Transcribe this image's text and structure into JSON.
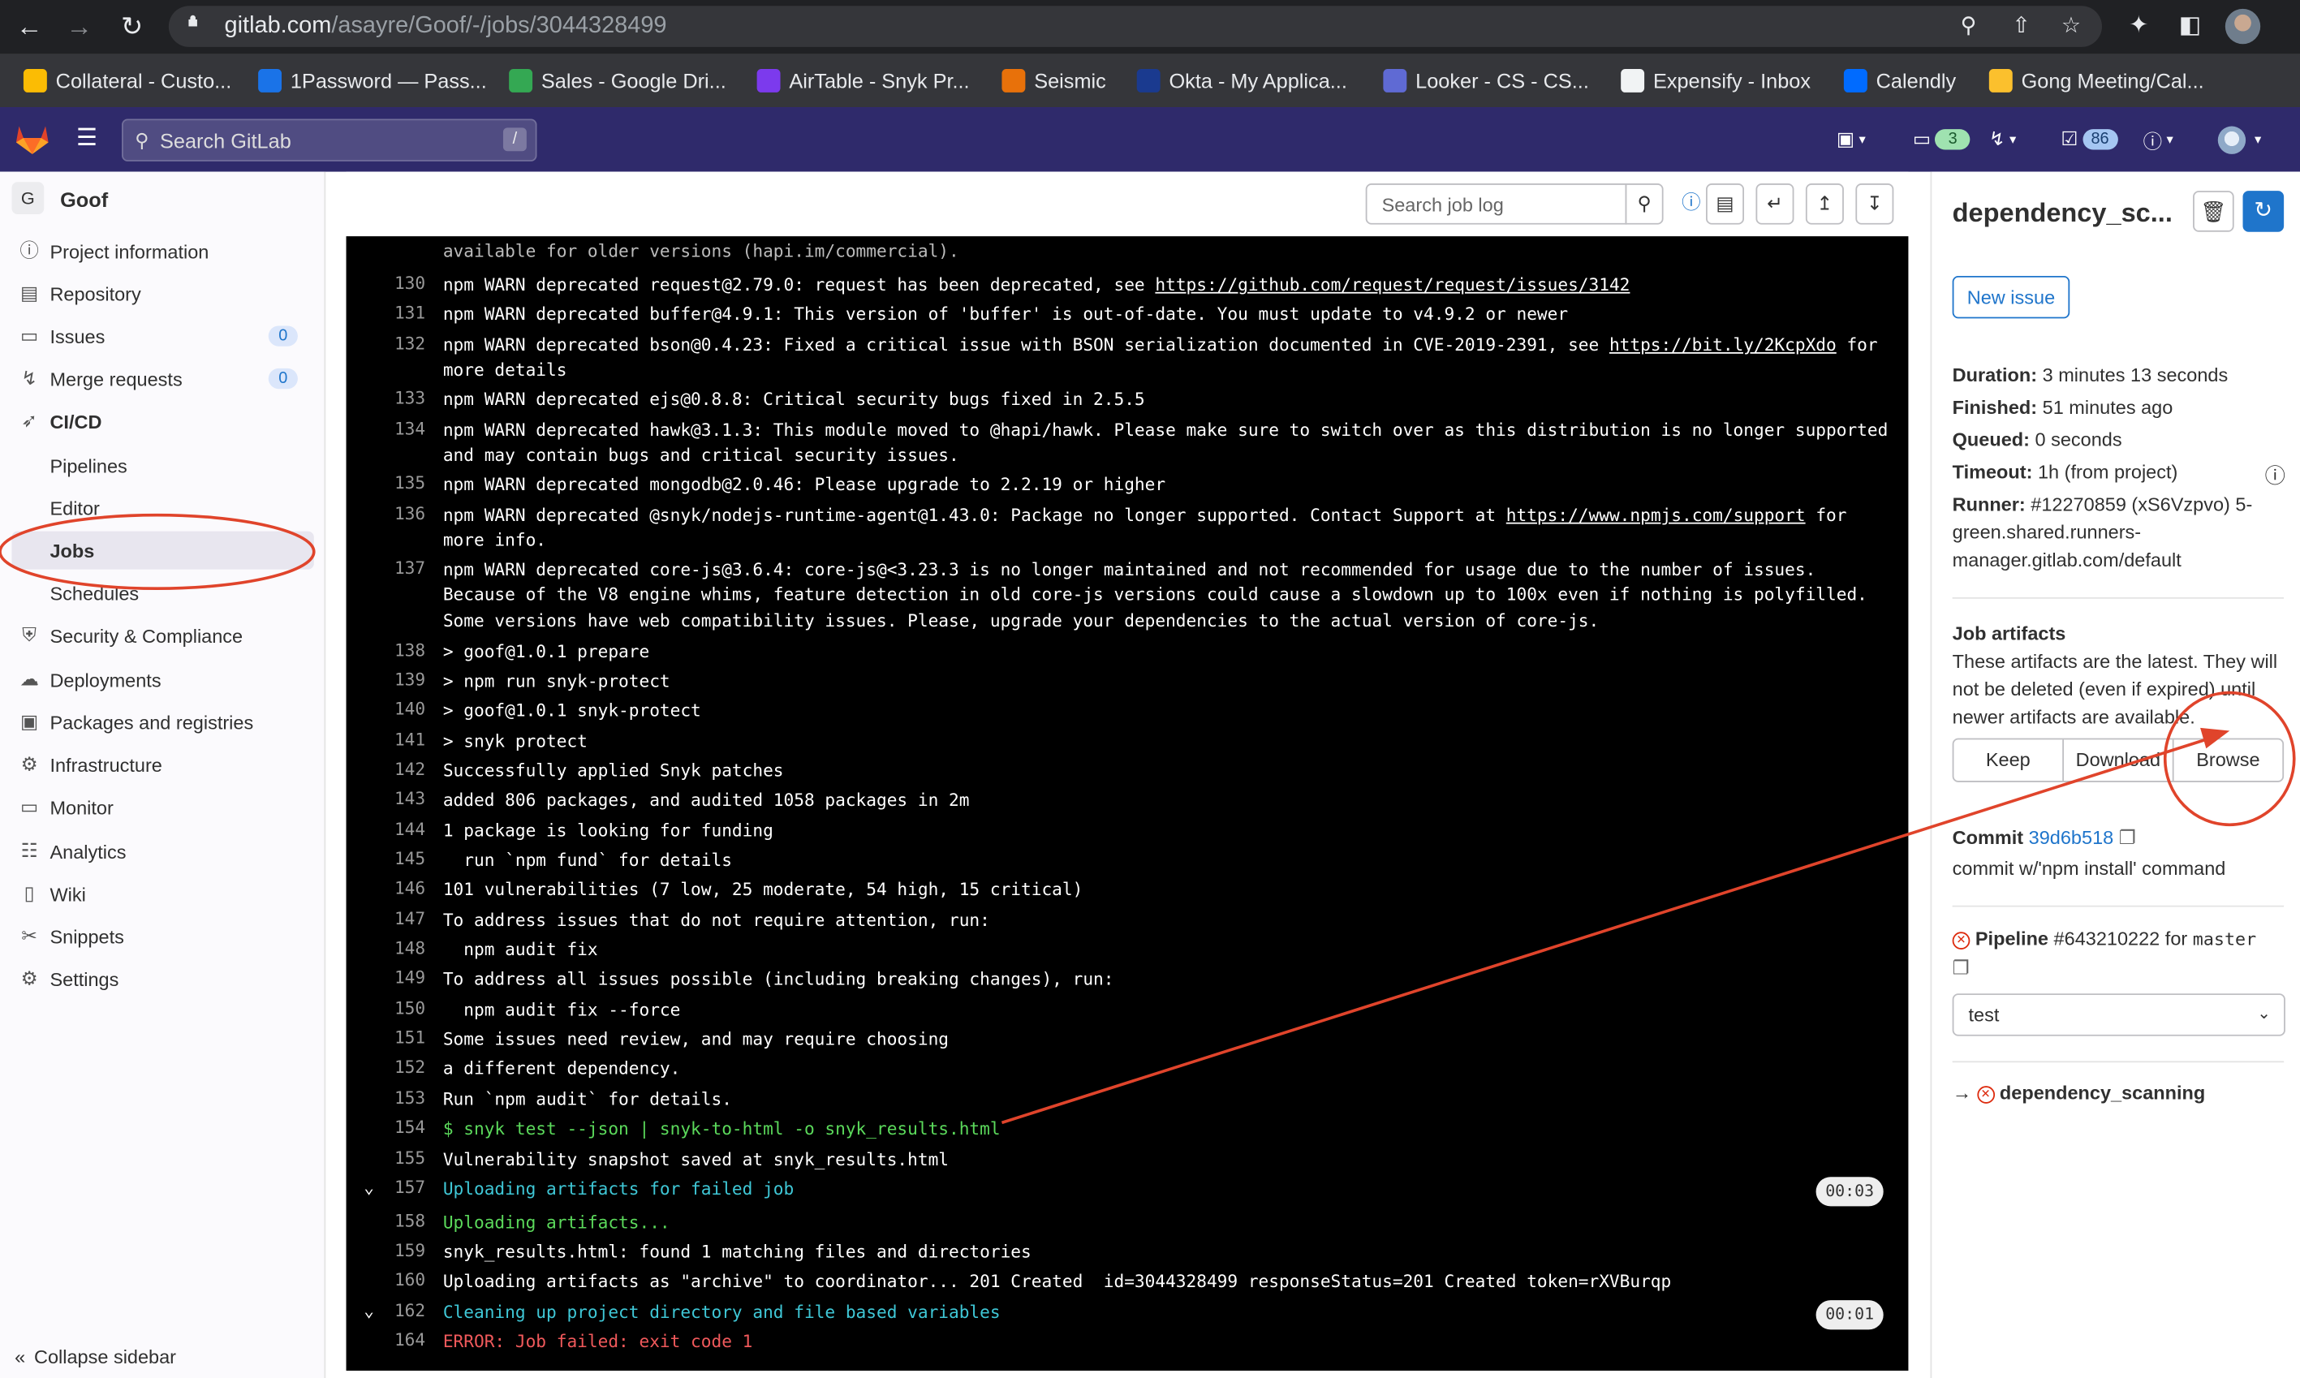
{
  "browser": {
    "url_host": "gitlab.com",
    "url_path": "/asayre/Goof/-/jobs/3044328499",
    "icons": [
      "back-icon",
      "forward-icon",
      "reload-icon",
      "lock-icon",
      "zoom-icon",
      "share-icon",
      "star-icon",
      "extensions-icon",
      "sidebar-icon",
      "profile-avatar"
    ],
    "bookmarks": [
      {
        "label": "Collateral - Custo...",
        "color": "#fbbc04"
      },
      {
        "label": "1Password — Pass...",
        "color": "#1a73e8"
      },
      {
        "label": "Sales - Google Dri...",
        "color": "#34a853"
      },
      {
        "label": "AirTable - Snyk Pr...",
        "color": "#7c3aed"
      },
      {
        "label": "Seismic",
        "color": "#e8710a"
      },
      {
        "label": "Okta - My Applica...",
        "color": "#1a3a8f"
      },
      {
        "label": "Looker - CS - CS...",
        "color": "#5f6ad4"
      },
      {
        "label": "Expensify - Inbox",
        "color": "#f1f3f4"
      },
      {
        "label": "Calendly",
        "color": "#006bff"
      },
      {
        "label": "Gong Meeting/Cal...",
        "color": "#fbc02d"
      }
    ]
  },
  "gitlab_header": {
    "search_placeholder": "Search GitLab",
    "search_kbd": "/",
    "issues_count": "3",
    "todos_count": "86",
    "accent": "#2f2a6b"
  },
  "sidebar": {
    "project_initial": "G",
    "project_name": "Goof",
    "items": [
      {
        "label": "Project information",
        "icon": "info-icon"
      },
      {
        "label": "Repository",
        "icon": "doc-icon"
      },
      {
        "label": "Issues",
        "icon": "issues-icon",
        "badge": "0"
      },
      {
        "label": "Merge requests",
        "icon": "merge-request-icon",
        "badge": "0"
      },
      {
        "label": "CI/CD",
        "icon": "rocket-icon"
      },
      {
        "label": "Pipelines"
      },
      {
        "label": "Editor"
      },
      {
        "label": "Jobs"
      },
      {
        "label": "Schedules"
      },
      {
        "label": "Security & Compliance",
        "icon": "shield-icon"
      },
      {
        "label": "Deployments",
        "icon": "deploy-icon"
      },
      {
        "label": "Packages and registries",
        "icon": "package-icon"
      },
      {
        "label": "Infrastructure",
        "icon": "cloud-icon"
      },
      {
        "label": "Monitor",
        "icon": "monitor-icon"
      },
      {
        "label": "Analytics",
        "icon": "chart-icon"
      },
      {
        "label": "Wiki",
        "icon": "book-icon"
      },
      {
        "label": "Snippets",
        "icon": "snippet-icon"
      },
      {
        "label": "Settings",
        "icon": "gear-icon"
      }
    ],
    "collapse_label": "Collapse sidebar"
  },
  "log_toolbar": {
    "search_placeholder": "Search job log"
  },
  "log": {
    "top_fragment": "available for older versions (hapi.im/commercial).",
    "lines": [
      {
        "n": "130",
        "parts": [
          {
            "t": "npm WARN deprecated request@2.79.0: request has been deprecated, see "
          },
          {
            "t": "https://github.com/request/request/issues/3142",
            "link": true
          }
        ]
      },
      {
        "n": "131",
        "parts": [
          {
            "t": "npm WARN deprecated buffer@4.9.1: This version of 'buffer' is out-of-date. You must update to v4.9.2 or newer"
          }
        ]
      },
      {
        "n": "132",
        "parts": [
          {
            "t": "npm WARN deprecated bson@0.4.23: Fixed a critical issue with BSON serialization documented in CVE-2019-2391, see "
          },
          {
            "t": "https://bit.ly/2KcpXdo",
            "link": true
          },
          {
            "t": " for more details"
          }
        ]
      },
      {
        "n": "133",
        "parts": [
          {
            "t": "npm WARN deprecated ejs@0.8.8: Critical security bugs fixed in 2.5.5"
          }
        ]
      },
      {
        "n": "134",
        "parts": [
          {
            "t": "npm WARN deprecated hawk@3.1.3: This module moved to @hapi/hawk. Please make sure to switch over as this distribution is no longer supported and may contain bugs and critical security issues."
          }
        ]
      },
      {
        "n": "135",
        "parts": [
          {
            "t": "npm WARN deprecated mongodb@2.0.46: Please upgrade to 2.2.19 or higher"
          }
        ]
      },
      {
        "n": "136",
        "parts": [
          {
            "t": "npm WARN deprecated @snyk/nodejs-runtime-agent@1.43.0: Package no longer supported. Contact Support at "
          },
          {
            "t": "https://www.npmjs.com/support",
            "link": true
          },
          {
            "t": " for more info."
          }
        ]
      },
      {
        "n": "137",
        "parts": [
          {
            "t": "npm WARN deprecated core-js@3.6.4: core-js@<3.23.3 is no longer maintained and not recommended for usage due to the number of issues. Because of the V8 engine whims, feature detection in old core-js versions could cause a slowdown up to 100x even if nothing is polyfilled. Some versions have web compatibility issues. Please, upgrade your dependencies to the actual version of core-js."
          }
        ]
      },
      {
        "n": "138",
        "parts": [
          {
            "t": "> goof@1.0.1 prepare"
          }
        ]
      },
      {
        "n": "139",
        "parts": [
          {
            "t": "> npm run snyk-protect"
          }
        ]
      },
      {
        "n": "140",
        "parts": [
          {
            "t": "> goof@1.0.1 snyk-protect"
          }
        ]
      },
      {
        "n": "141",
        "parts": [
          {
            "t": "> snyk protect"
          }
        ]
      },
      {
        "n": "142",
        "parts": [
          {
            "t": "Successfully applied Snyk patches"
          }
        ]
      },
      {
        "n": "143",
        "parts": [
          {
            "t": "added 806 packages, and audited 1058 packages in 2m"
          }
        ]
      },
      {
        "n": "144",
        "parts": [
          {
            "t": "1 package is looking for funding"
          }
        ]
      },
      {
        "n": "145",
        "parts": [
          {
            "t": "  run `npm fund` for details"
          }
        ]
      },
      {
        "n": "146",
        "parts": [
          {
            "t": "101 vulnerabilities (7 low, 25 moderate, 54 high, 15 critical)"
          }
        ]
      },
      {
        "n": "147",
        "parts": [
          {
            "t": "To address issues that do not require attention, run:"
          }
        ]
      },
      {
        "n": "148",
        "parts": [
          {
            "t": "  npm audit fix"
          }
        ]
      },
      {
        "n": "149",
        "parts": [
          {
            "t": "To address all issues possible (including breaking changes), run:"
          }
        ]
      },
      {
        "n": "150",
        "parts": [
          {
            "t": "  npm audit fix --force"
          }
        ]
      },
      {
        "n": "151",
        "parts": [
          {
            "t": "Some issues need review, and may require choosing"
          }
        ]
      },
      {
        "n": "152",
        "parts": [
          {
            "t": "a different dependency."
          }
        ]
      },
      {
        "n": "153",
        "parts": [
          {
            "t": "Run `npm audit` for details."
          }
        ]
      },
      {
        "n": "154",
        "parts": [
          {
            "t": "$ snyk test --json | snyk-to-html -o snyk_results.html",
            "style": "g"
          }
        ]
      },
      {
        "n": "155",
        "parts": [
          {
            "t": "Vulnerability snapshot saved at snyk_results.html"
          }
        ]
      },
      {
        "n": "157",
        "section": true,
        "time": "00:03",
        "parts": [
          {
            "t": "Uploading artifacts for failed job",
            "style": "c"
          }
        ]
      },
      {
        "n": "158",
        "parts": [
          {
            "t": "Uploading artifacts...",
            "style": "g"
          }
        ]
      },
      {
        "n": "159",
        "parts": [
          {
            "t": "snyk_results.html: found 1 matching files and directories"
          }
        ]
      },
      {
        "n": "160",
        "parts": [
          {
            "t": "Uploading artifacts as \"archive\" to coordinator... 201 Created  id=3044328499 responseStatus=201 Created token=rXVBurqp"
          }
        ]
      },
      {
        "n": "162",
        "section": true,
        "time": "00:01",
        "parts": [
          {
            "t": "Cleaning up project directory and file based variables",
            "style": "c"
          }
        ]
      },
      {
        "n": "164",
        "parts": [
          {
            "t": "ERROR: Job failed: exit code 1",
            "style": "r"
          }
        ]
      }
    ]
  },
  "job_panel": {
    "title": "dependency_sc...",
    "new_issue_label": "New issue",
    "duration_label": "Duration:",
    "duration_value": "3 minutes 13 seconds",
    "finished_label": "Finished:",
    "finished_value": "51 minutes ago",
    "queued_label": "Queued:",
    "queued_value": "0 seconds",
    "timeout_label": "Timeout:",
    "timeout_value": "1h (from project)",
    "runner_label": "Runner:",
    "runner_value_1": "#12270859 (xS6Vzpvo) 5-",
    "runner_value_2": "green.shared.runners-",
    "runner_value_3": "manager.gitlab.com/default",
    "artifacts_title": "Job artifacts",
    "artifacts_text_1": "These artifacts are the latest. They will",
    "artifacts_text_2": "not be deleted (even if expired) until",
    "artifacts_text_3": "newer artifacts are available.",
    "keep_label": "Keep",
    "download_label": "Download",
    "browse_label": "Browse",
    "commit_label": "Commit",
    "commit_sha": "39d6b518",
    "commit_message": "commit w/'npm install' command",
    "pipeline_label": "Pipeline",
    "pipeline_id": "#643210222",
    "pipeline_for": "for",
    "pipeline_branch": "master",
    "stage_value": "test",
    "job_link": "dependency_scanning"
  },
  "annotation": {
    "color": "#e0442b"
  }
}
